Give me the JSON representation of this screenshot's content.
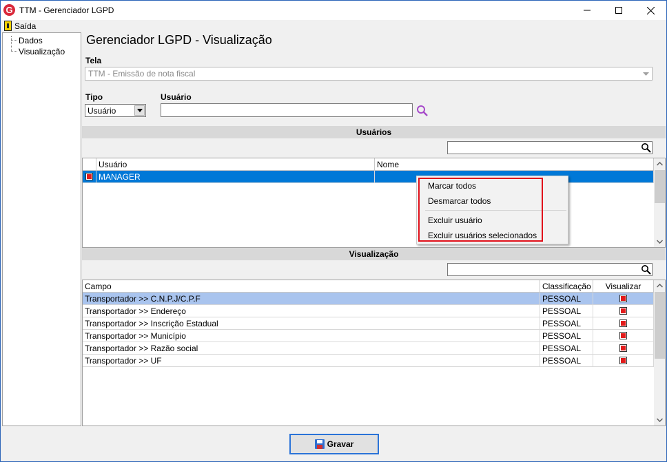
{
  "window": {
    "title": "TTM - Gerenciador LGPD",
    "app_icon_glyph": "G"
  },
  "menubar": {
    "exit_label": "Saída"
  },
  "tree": {
    "items": [
      "Dados",
      "Visualização"
    ]
  },
  "main": {
    "title": "Gerenciador LGPD - Visualização",
    "tela_label": "Tela",
    "tela_value": "TTM - Emissão de nota fiscal",
    "tipo_label": "Tipo",
    "tipo_value": "Usuário",
    "usuario_label": "Usuário",
    "usuario_value": ""
  },
  "users_section": {
    "title": "Usuários",
    "search_value": "",
    "headers": [
      "Usuário",
      "Nome"
    ],
    "rows": [
      {
        "checked": true,
        "usuario": "MANAGER",
        "nome": ""
      }
    ]
  },
  "context_menu": {
    "items": [
      "Marcar todos",
      "Desmarcar todos",
      "Excluir usuário",
      "Excluir usuários selecionados"
    ]
  },
  "view_section": {
    "title": "Visualização",
    "search_value": "",
    "headers": [
      "Campo",
      "Classificação",
      "Visualizar"
    ],
    "rows": [
      {
        "campo": "Transportador >> C.N.P.J/C.P.F",
        "classificacao": "PESSOAL",
        "visualizar": true
      },
      {
        "campo": "Transportador >> Endereço",
        "classificacao": "PESSOAL",
        "visualizar": true
      },
      {
        "campo": "Transportador >> Inscrição Estadual",
        "classificacao": "PESSOAL",
        "visualizar": true
      },
      {
        "campo": "Transportador >> Município",
        "classificacao": "PESSOAL",
        "visualizar": true
      },
      {
        "campo": "Transportador >> Razão social",
        "classificacao": "PESSOAL",
        "visualizar": true
      },
      {
        "campo": "Transportador >> UF",
        "classificacao": "PESSOAL",
        "visualizar": true
      }
    ]
  },
  "footer": {
    "save_label": "Gravar"
  },
  "colors": {
    "selection": "#0078d7",
    "row_highlight": "#a9c4ee",
    "accent_border": "#e0101a",
    "search_icon": "#a64ac9"
  }
}
